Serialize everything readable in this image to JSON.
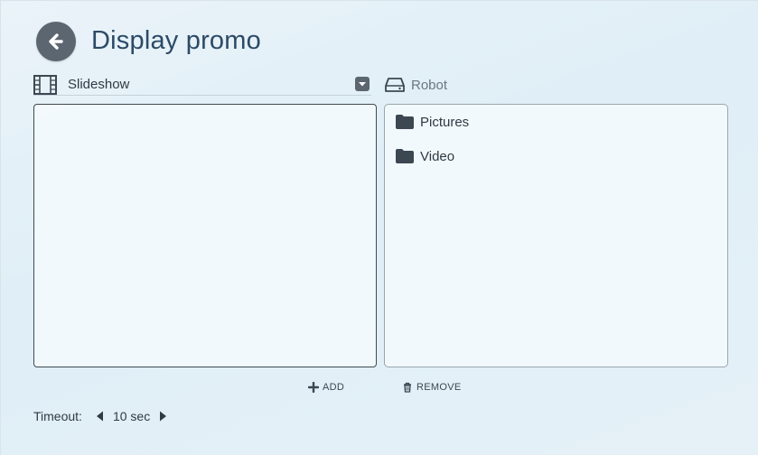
{
  "header": {
    "title": "Display promo",
    "back_icon": "arrow-left-circle-icon"
  },
  "left_column": {
    "label": "Slideshow",
    "icon": "film-icon",
    "dropdown_icon": "caret-down-icon",
    "items": []
  },
  "right_column": {
    "label": "Robot",
    "icon": "hard-drive-icon",
    "items": [
      {
        "label": "Pictures",
        "icon": "folder-icon"
      },
      {
        "label": "Video",
        "icon": "folder-icon"
      }
    ]
  },
  "actions": {
    "add_label": "ADD",
    "add_icon": "plus-icon",
    "remove_label": "REMOVE",
    "remove_icon": "trash-icon"
  },
  "timeout": {
    "label": "Timeout:",
    "value": "10 sec",
    "decrement_icon": "caret-left-icon",
    "increment_icon": "caret-right-icon"
  },
  "colors": {
    "accent": "#5b6670",
    "title": "#2c4a66",
    "background": "#e4f0f7"
  }
}
